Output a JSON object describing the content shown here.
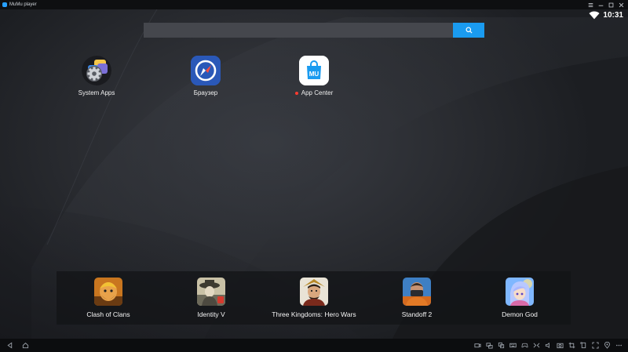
{
  "window": {
    "title": "MuMu player"
  },
  "status": {
    "time": "10:31",
    "wifi_icon": "wifi-icon"
  },
  "search": {
    "value": "",
    "placeholder": "",
    "button_icon": "search-icon"
  },
  "desktop_apps": [
    {
      "id": "system-apps",
      "label": "System Apps",
      "icon": "gear-folder-icon",
      "new_badge": false
    },
    {
      "id": "browser",
      "label": "Браузер",
      "icon": "compass-icon",
      "new_badge": false
    },
    {
      "id": "app-center",
      "label": "App Center",
      "icon": "mumu-bag-icon",
      "new_badge": true
    }
  ],
  "dock_apps": [
    {
      "id": "clash-of-clans",
      "label": "Clash of Clans"
    },
    {
      "id": "identity-v",
      "label": "Identity V"
    },
    {
      "id": "three-kingdoms",
      "label": "Three Kingdoms: Hero Wars"
    },
    {
      "id": "standoff-2",
      "label": "Standoff 2"
    },
    {
      "id": "demon-god",
      "label": "Demon God"
    }
  ],
  "app_center_logo_text": "MU",
  "colors": {
    "accent": "#1a9bf0",
    "badge": "#ff3b30",
    "browser_bg": "#2a58b8",
    "titlebar": "#0e0f11"
  }
}
